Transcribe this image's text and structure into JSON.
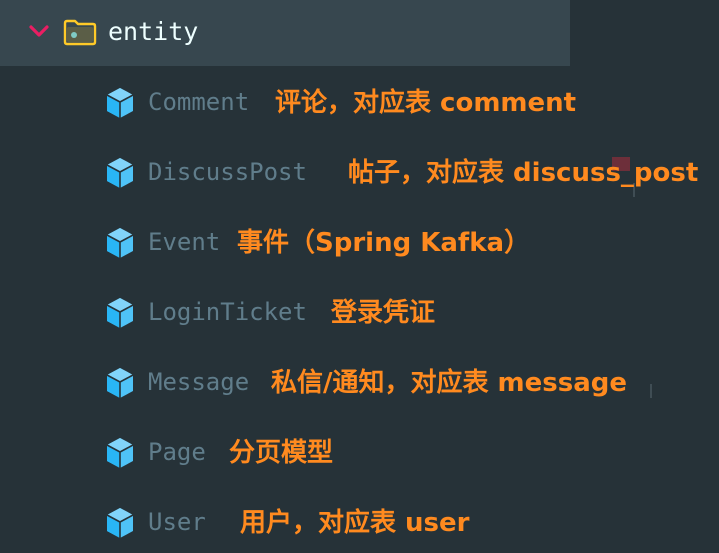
{
  "tree": {
    "folder": {
      "name": "entity",
      "expanded": true,
      "icon": "folder-open-icon"
    },
    "items": [
      {
        "name": "Comment",
        "note": "评论，对应表 comment",
        "icon": "class-cube-icon"
      },
      {
        "name": "DiscussPost",
        "note": "帖子，对应表 discuss_post",
        "icon": "class-cube-icon"
      },
      {
        "name": "Event",
        "note": "事件（Spring Kafka）",
        "icon": "class-cube-icon"
      },
      {
        "name": "LoginTicket",
        "note": "登录凭证",
        "icon": "class-cube-icon"
      },
      {
        "name": "Message",
        "note": "私信/通知，对应表 message",
        "icon": "class-cube-icon"
      },
      {
        "name": "Page",
        "note": "分页模型",
        "icon": "class-cube-icon"
      },
      {
        "name": "User",
        "note": "用户，对应表 user",
        "icon": "class-cube-icon"
      }
    ]
  },
  "colors": {
    "background": "#263238",
    "selected_row": "#37474f",
    "chevron": "#e91e63",
    "folder": "#ffca28",
    "cube": "#4fc3f7",
    "file_text": "#607d8b",
    "annotation": "#ff8a1f"
  }
}
